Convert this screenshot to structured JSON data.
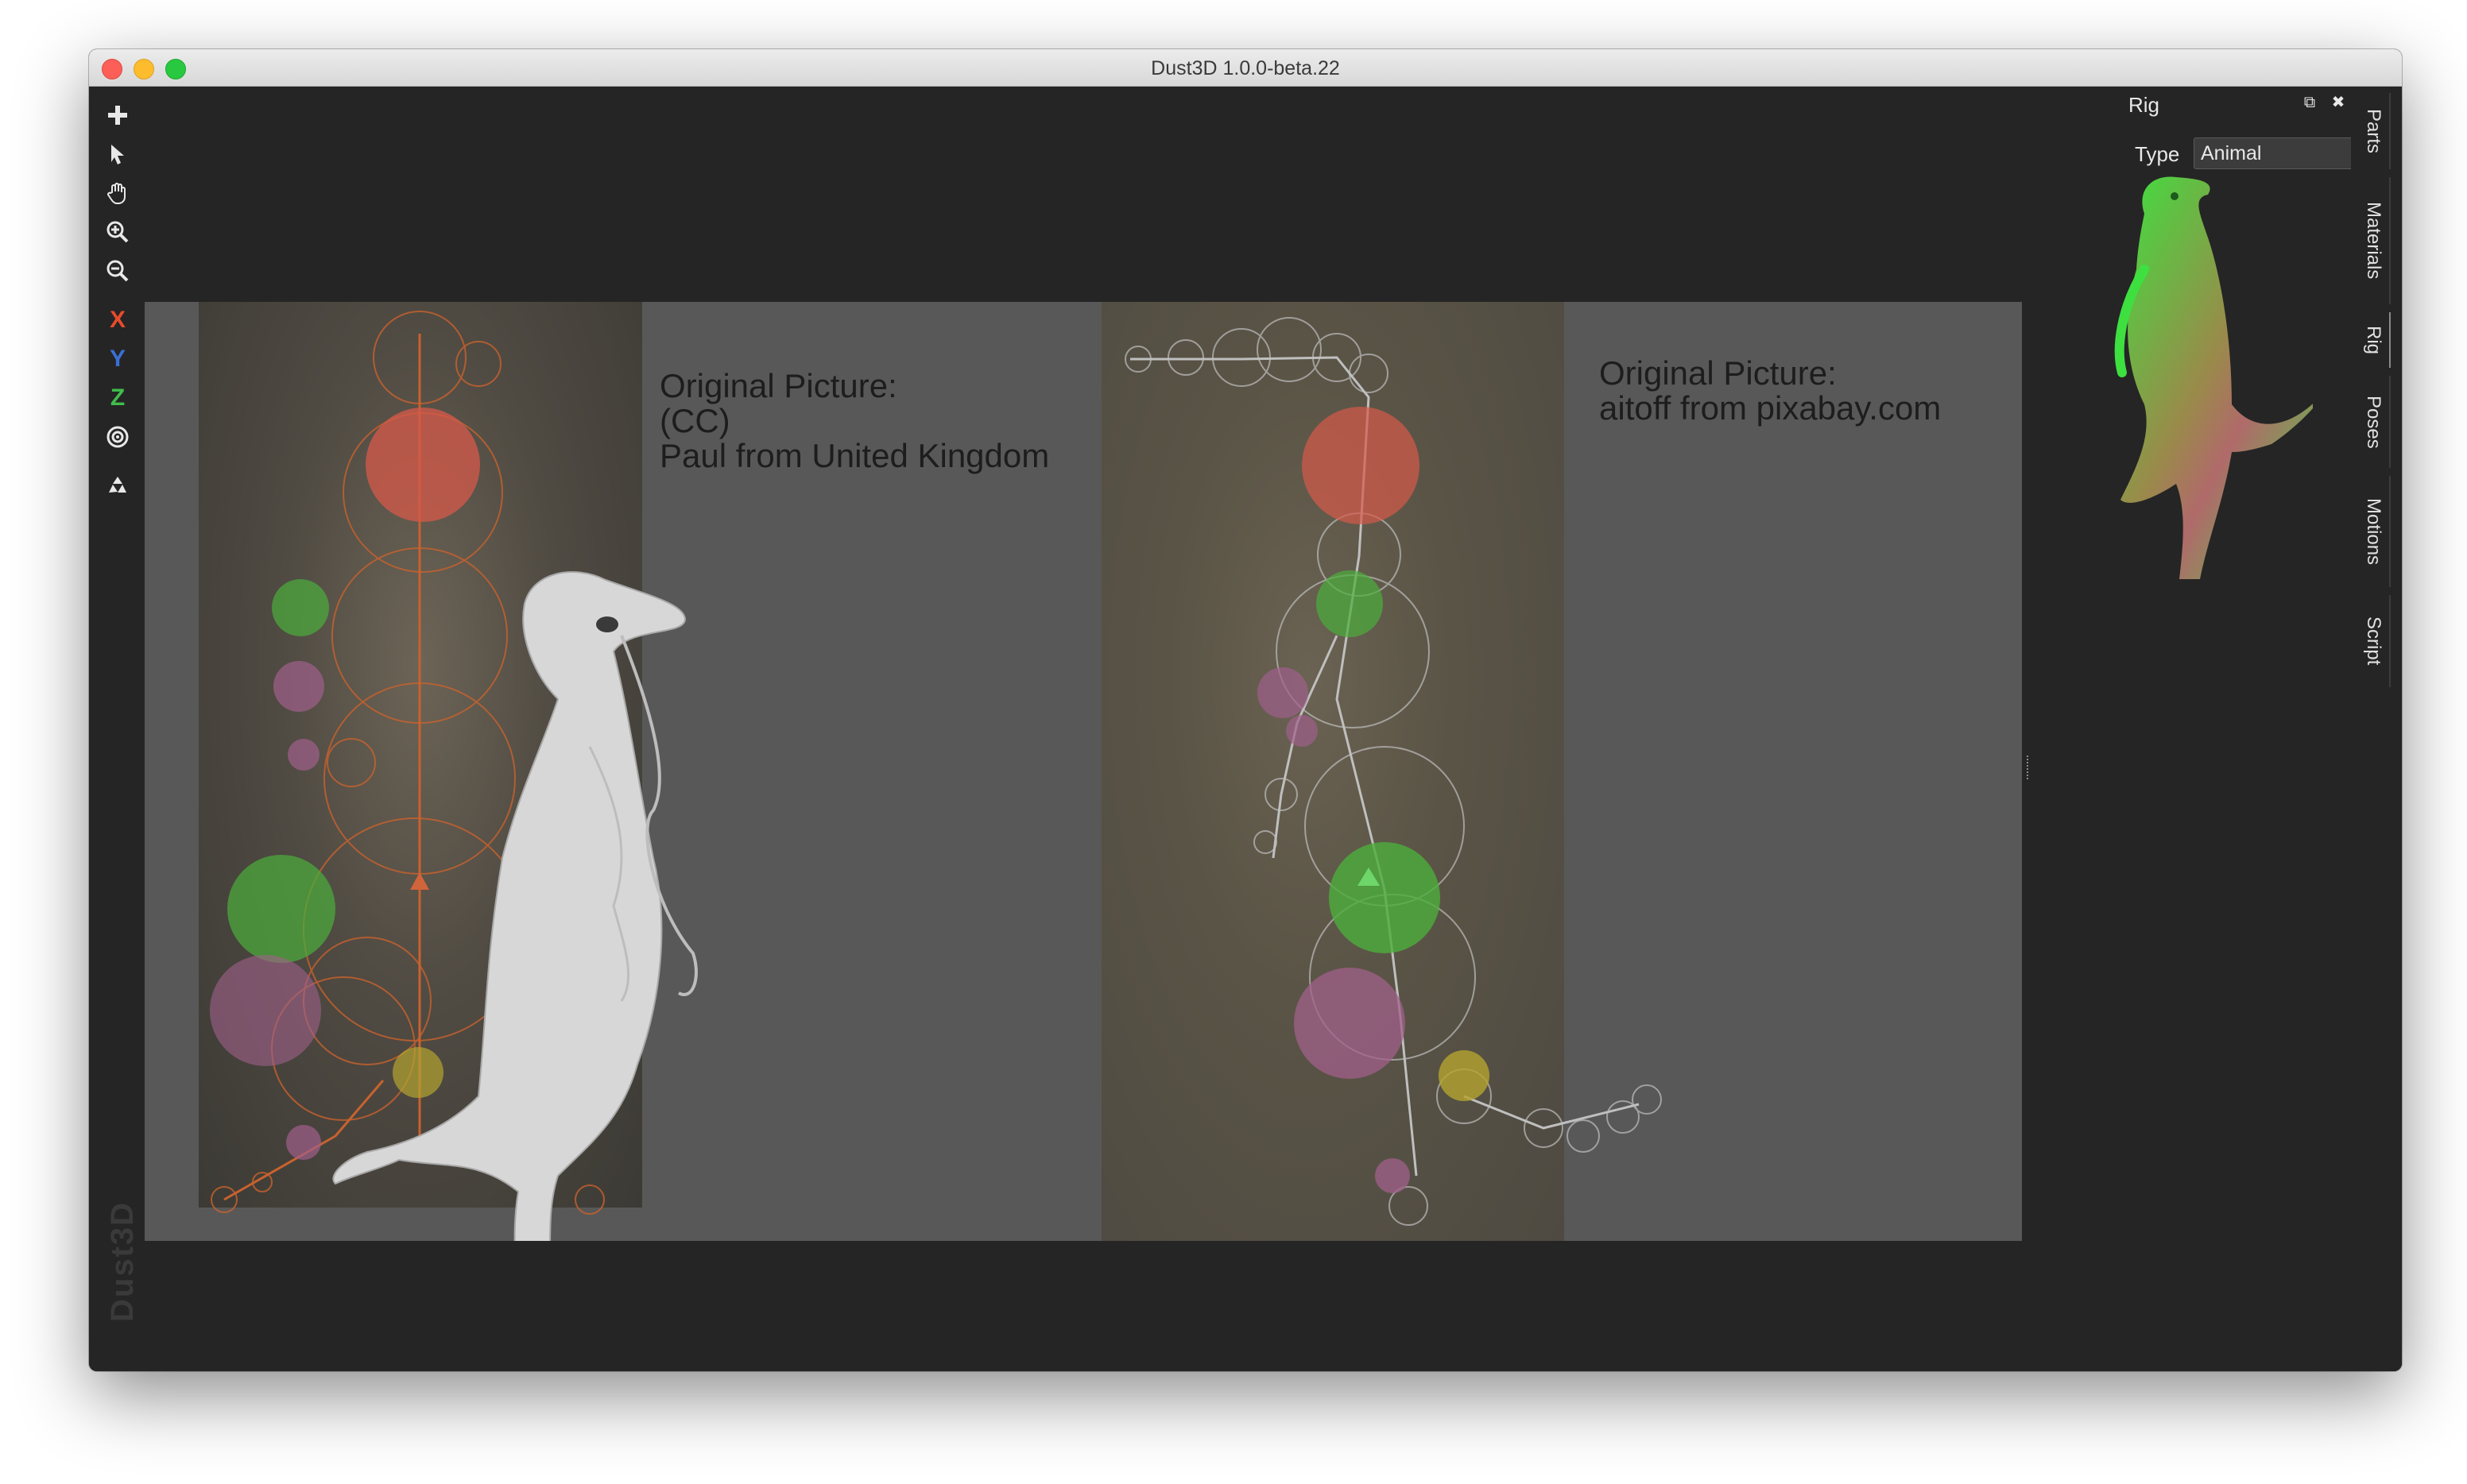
{
  "window": {
    "title": "Dust3D 1.0.0-beta.22"
  },
  "toolbar": {
    "tools": [
      {
        "name": "add-icon",
        "glyph": "✚"
      },
      {
        "name": "select-pointer-icon",
        "glyph": "➤"
      },
      {
        "name": "hand-icon",
        "glyph": "✋"
      },
      {
        "name": "zoom-in-icon",
        "glyph": "⊕"
      },
      {
        "name": "zoom-out-icon",
        "glyph": "⊖"
      },
      {
        "name": "x-axis",
        "glyph": "X"
      },
      {
        "name": "y-axis",
        "glyph": "Y"
      },
      {
        "name": "z-axis",
        "glyph": "Z"
      },
      {
        "name": "radius-icon",
        "glyph": "◎"
      },
      {
        "name": "regenerate-icon",
        "glyph": "♻"
      }
    ]
  },
  "watermark": "Dust3D",
  "canvas": {
    "caption_front": [
      "Original Picture:",
      "(CC)",
      "Paul from United Kingdom"
    ],
    "caption_side": [
      "Original Picture:",
      "aitoff from pixabay.com"
    ]
  },
  "rig": {
    "title": "Rig",
    "type_label": "Type",
    "type_value": "Animal"
  },
  "tabs": [
    "Parts",
    "Materials",
    "Rig",
    "Poses",
    "Motions",
    "Script"
  ],
  "colors": {
    "background": "#252525",
    "canvas": "#585858",
    "axis_x": "#e84b2b",
    "axis_y": "#3a6fd6",
    "axis_z": "#3fbf4a",
    "preview_green": "#3ee040"
  }
}
